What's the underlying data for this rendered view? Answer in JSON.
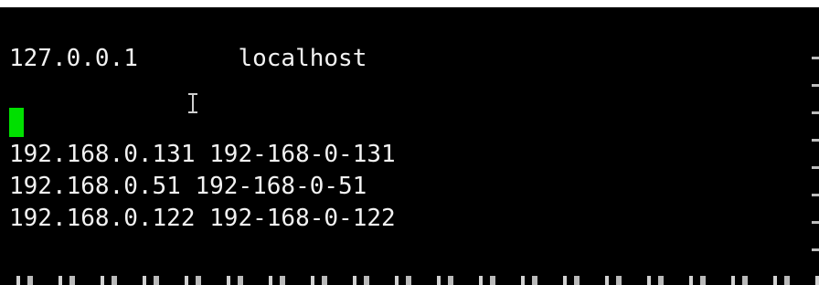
{
  "terminal": {
    "lines": [
      {
        "ip": "127.0.0.1",
        "spacer": "       ",
        "host": "localhost"
      },
      {
        "ip": "192.168.0.131",
        "spacer": " ",
        "host": "192-168-0-131"
      },
      {
        "ip": "192.168.0.51",
        "spacer": " ",
        "host": "192-168-0-51"
      },
      {
        "ip": "192.168.0.122",
        "spacer": " ",
        "host": "192-168-0-122"
      }
    ]
  },
  "colors": {
    "background": "#000000",
    "text": "#f2f2f2",
    "cursor": "#00e000"
  },
  "icons": {
    "mouse_pointer": "i-beam-icon"
  }
}
